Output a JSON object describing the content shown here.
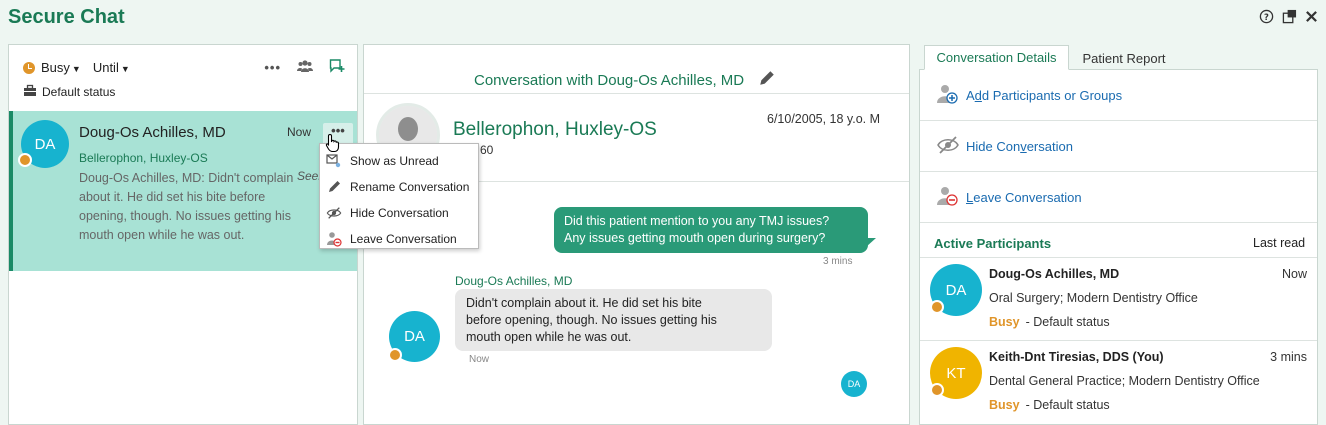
{
  "app": {
    "title": "Secure Chat"
  },
  "left_panel": {
    "status_label": "Busy",
    "until_label": "Until",
    "default_status": "Default status",
    "conversation": {
      "initials": "DA",
      "name": "Doug-Os Achilles, MD",
      "time": "Now",
      "more": "•••",
      "patient": "Bellerophon, Huxley-OS",
      "preview": "Doug-Os Achilles, MD: Didn't complain about it. He did set his bite before opening, though. No issues getting his mouth open while he was out.",
      "seen": "Seen"
    },
    "context_menu": [
      {
        "label": "Show as Unread",
        "icon": "show-unread-icon"
      },
      {
        "label": "Rename Conversation",
        "icon": "pencil-icon"
      },
      {
        "label": "Hide Conversation",
        "icon": "eye-slash-icon"
      },
      {
        "label": "Leave Conversation",
        "icon": "leave-person-icon"
      }
    ]
  },
  "middle_panel": {
    "title": "Conversation with Doug-Os Achilles, MD",
    "patient_name": "Bellerophon, Huxley-OS",
    "patient_sub": "60",
    "patient_dob": "6/10/2005, 18 y.o. M",
    "messages": {
      "outgoing": {
        "text_line1": "Did this patient mention to you any TMJ issues?",
        "text_line2": "Any issues getting mouth open during surgery?",
        "time": "3 mins"
      },
      "incoming": {
        "sender": "Doug-Os Achilles, MD",
        "text_line1": "Didn't complain about it. He did set his bite",
        "text_line2": "before opening, though. No issues getting his",
        "text_line3": "mouth open while he was out.",
        "time": "Now",
        "initials": "DA"
      },
      "read_receipt_initials": "DA"
    }
  },
  "right_panel": {
    "tabs": [
      "Conversation Details",
      "Patient Report"
    ],
    "actions": {
      "add_pre": "A",
      "add_ul": "d",
      "add_post": "d Participants or Groups",
      "hide_pre": "Hide Con",
      "hide_ul": "v",
      "hide_post": "ersation",
      "leave_ul": "L",
      "leave_post": "eave Conversation"
    },
    "participants_title": "Active Participants",
    "last_read_title": "Last read",
    "participants": [
      {
        "initials": "DA",
        "name": "Doug-Os Achilles, MD",
        "time": "Now",
        "org": "Oral Surgery; Modern Dentistry Office",
        "status": "Busy",
        "status_note": "- Default status"
      },
      {
        "initials": "KT",
        "name": "Keith-Dnt Tiresias, DDS (You)",
        "time": "3 mins",
        "org": "Dental General Practice; Modern Dentistry Office",
        "status": "Busy",
        "status_note": "- Default status"
      }
    ]
  },
  "colors": {
    "brand_green": "#1a7a55",
    "selected_bg": "#a8e2d5",
    "busy_orange": "#e0952a",
    "avatar_teal": "#17b3cf",
    "avatar_yellow": "#f0b400",
    "link_blue": "#1a6bb0"
  }
}
